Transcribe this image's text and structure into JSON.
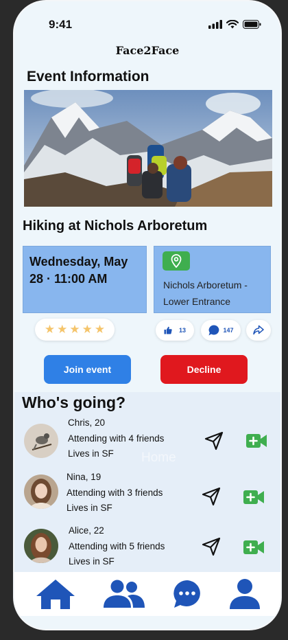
{
  "status_bar": {
    "time": "9:41"
  },
  "app": {
    "title": "Face2Face"
  },
  "event": {
    "section_title": "Event Information",
    "name": "Hiking at Nichols Arboretum",
    "date": "Wednesday, May 28 · 11:00 AM",
    "location": "Nichols Arboretum - Lower Entrance",
    "rating": 5,
    "likes": "13",
    "comments": "147"
  },
  "actions": {
    "join_label": "Join event",
    "decline_label": "Decline"
  },
  "going": {
    "title": "Who's going?",
    "people": [
      {
        "name": "Chris, 20",
        "attending": "Attending with 4 friends",
        "location": "Lives in SF"
      },
      {
        "name": "Nina, 19",
        "attending": "Attending with  3 friends",
        "location": "Lives in SF"
      },
      {
        "name": "Alice, 22",
        "attending": "Attending with 5 friends",
        "location": "Lives in SF"
      }
    ]
  },
  "overlay_text": "Home",
  "nav": {
    "items": [
      {
        "icon": "home-icon"
      },
      {
        "icon": "people-icon"
      },
      {
        "icon": "chat-icon"
      },
      {
        "icon": "profile-icon"
      }
    ]
  },
  "colors": {
    "primary": "#1f55b8",
    "join": "#2f80e6",
    "decline": "#e0181e",
    "card": "#88b6ee",
    "green": "#3fae4f"
  }
}
